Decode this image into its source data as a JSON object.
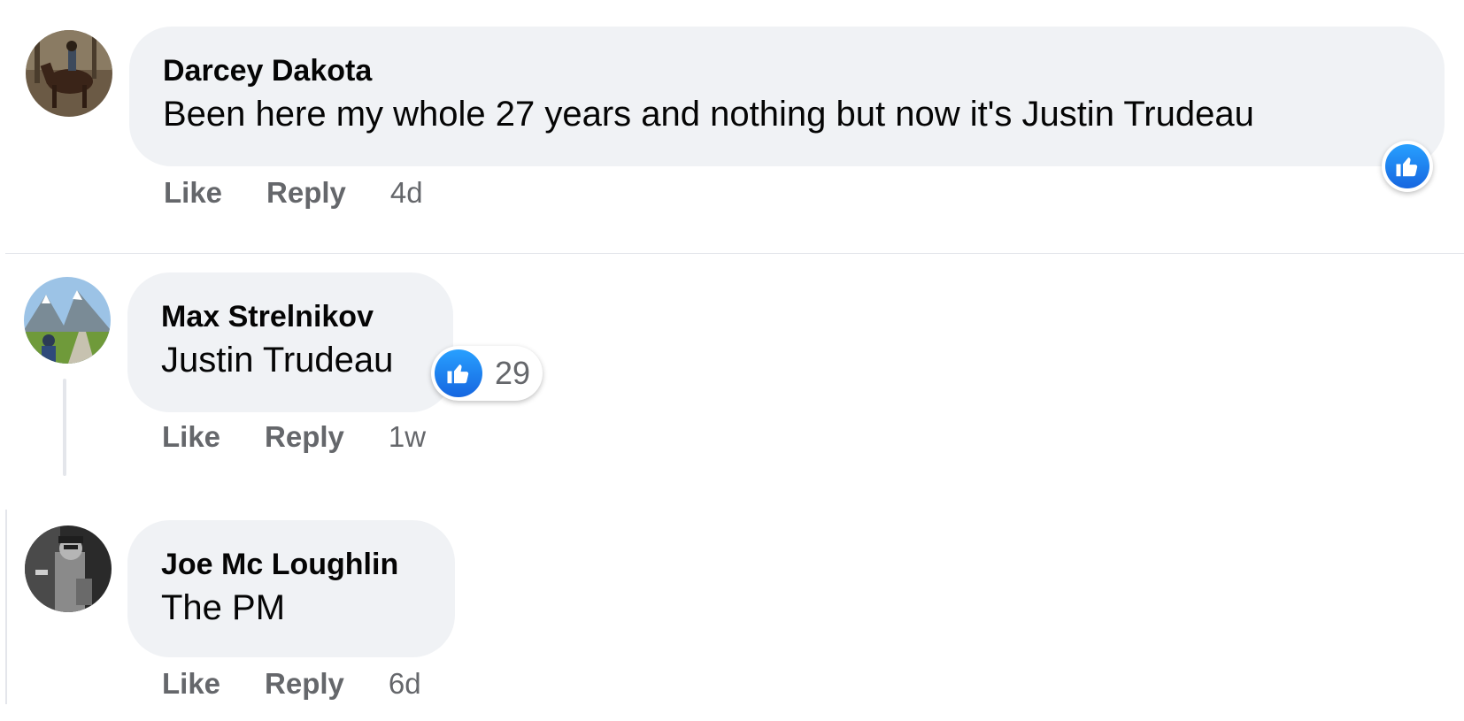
{
  "comments": [
    {
      "author": "Darcey Dakota",
      "text": "Been here my whole 27 years and nothing but now it's Justin Trudeau",
      "like_label": "Like",
      "reply_label": "Reply",
      "time": "4d",
      "reaction_icon": "like-reaction-icon"
    },
    {
      "author": "Max Strelnikov",
      "text": "Justin Trudeau",
      "like_label": "Like",
      "reply_label": "Reply",
      "time": "1w",
      "reaction_icon": "like-reaction-icon",
      "reaction_count": "29"
    },
    {
      "author": "Joe Mc Loughlin",
      "text": "The PM",
      "like_label": "Like",
      "reply_label": "Reply",
      "time": "6d"
    }
  ],
  "colors": {
    "bubble_bg": "#f0f2f5",
    "meta_text": "#65676b",
    "like_blue": "#1877f2"
  }
}
